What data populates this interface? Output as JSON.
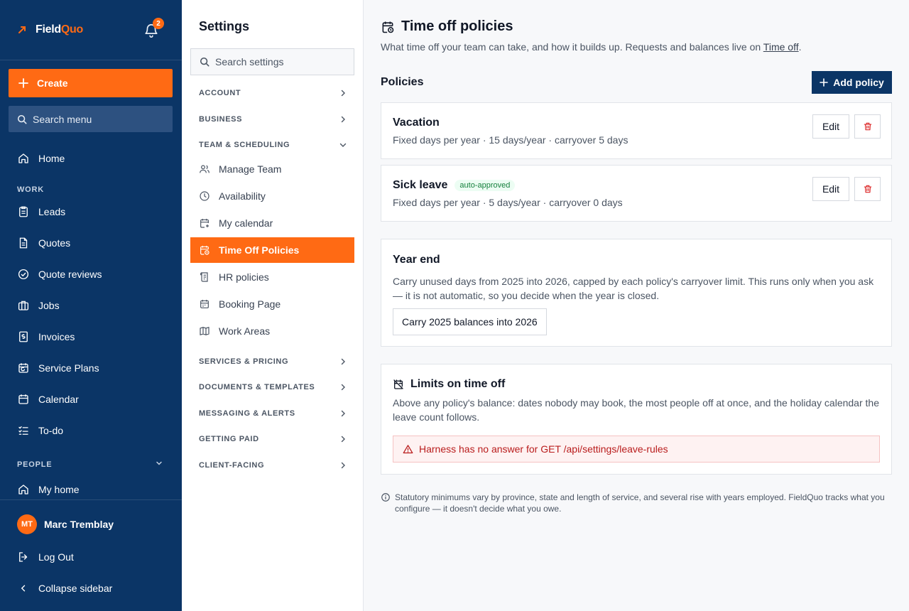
{
  "brand": {
    "name_part1": "Field",
    "name_part2": "Quo",
    "accent": "#ff6a14",
    "nav_bg": "#0b3566"
  },
  "notifications": {
    "count": "2",
    "icon": "bell-icon"
  },
  "nav": {
    "create_label": "Create",
    "search_placeholder": "Search menu",
    "home": "Home",
    "section_work": "WORK",
    "work_items": [
      "Leads",
      "Quotes",
      "Quote reviews",
      "Jobs",
      "Invoices",
      "Service Plans",
      "Calendar",
      "To-do"
    ],
    "section_people": "PEOPLE",
    "my_home": "My home",
    "user": {
      "initials": "MT",
      "name": "Marc Tremblay"
    },
    "logout": "Log Out",
    "collapse": "Collapse sidebar"
  },
  "settings": {
    "title": "Settings",
    "search_placeholder": "Search settings",
    "sections": {
      "account": "ACCOUNT",
      "business": "BUSINESS",
      "team": "TEAM & SCHEDULING",
      "services": "SERVICES & PRICING",
      "documents": "DOCUMENTS & TEMPLATES",
      "messaging": "MESSAGING & ALERTS",
      "getting_paid": "GETTING PAID",
      "client_facing": "CLIENT-FACING"
    },
    "team_items": [
      "Manage Team",
      "Availability",
      "My calendar",
      "Time Off Policies",
      "HR policies",
      "Booking Page",
      "Work Areas"
    ],
    "active_item": "Time Off Policies"
  },
  "main": {
    "title": "Time off policies",
    "subtitle_prefix": "What time off your team can take, and how it builds up. Requests and balances live on ",
    "subtitle_link": "Time off",
    "subtitle_suffix": ".",
    "policies_heading": "Policies",
    "add_policy_label": "Add policy",
    "policies": [
      {
        "name": "Vacation",
        "badge": "",
        "meta": "Fixed days per year · 15 days/year · carryover 5 days",
        "edit": "Edit"
      },
      {
        "name": "Sick leave",
        "badge": "auto-approved",
        "meta": "Fixed days per year · 5 days/year · carryover 0 days",
        "edit": "Edit"
      }
    ],
    "year_end": {
      "title": "Year end",
      "text": "Carry unused days from 2025 into 2026, capped by each policy's carryover limit. This runs only when you ask — it is not automatic, so you decide when the year is closed.",
      "button": "Carry 2025 balances into 2026"
    },
    "limits": {
      "title": "Limits on time off",
      "text": "Above any policy's balance: dates nobody may book, the most people off at once, and the holiday calendar the leave count follows.",
      "error": "Harness has no answer for GET /api/settings/leave-rules"
    },
    "footnote": "Statutory minimums vary by province, state and length of service, and several rise with years employed. FieldQuo tracks what you configure — it doesn't decide what you owe."
  }
}
